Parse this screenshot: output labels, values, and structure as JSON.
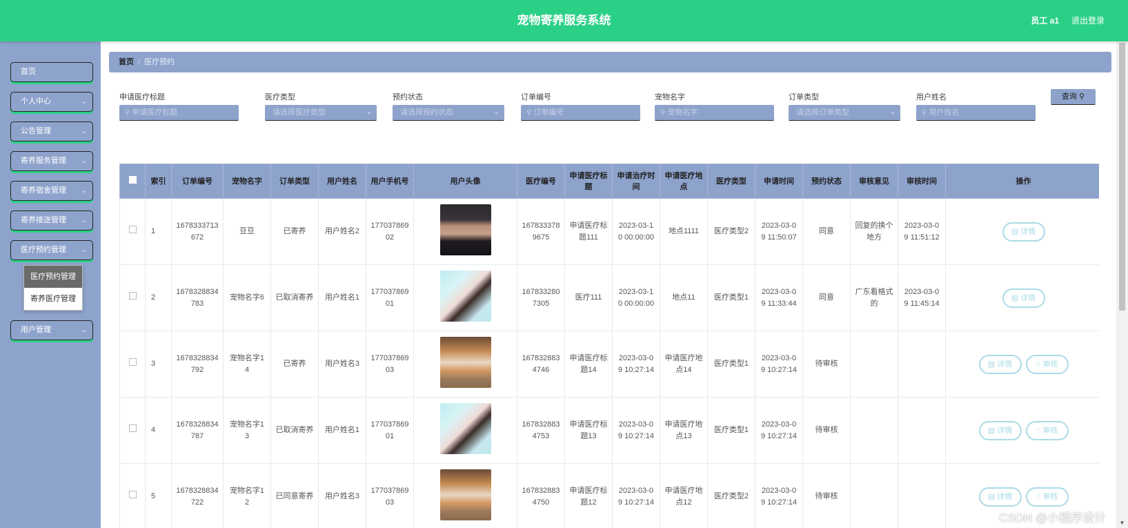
{
  "header": {
    "title": "宠物寄养服务系统",
    "user": "员工 a1",
    "logout": "退出登录"
  },
  "sidebar": {
    "items": [
      {
        "label": "首页",
        "chevron": ""
      },
      {
        "label": "个人中心",
        "chevron": "⌄"
      },
      {
        "label": "公告管理",
        "chevron": "⌄"
      },
      {
        "label": "寄养服务管理",
        "chevron": "⌄"
      },
      {
        "label": "寄养宿舍管理",
        "chevron": "⌄"
      },
      {
        "label": "寄养接送管理",
        "chevron": "⌄"
      },
      {
        "label": "医疗预约管理",
        "chevron": "⌄"
      },
      {
        "label": "用户管理",
        "chevron": "⌄"
      }
    ],
    "submenu": [
      {
        "label": "医疗预约管理",
        "active": true
      },
      {
        "label": "寄养医疗管理",
        "active": false
      }
    ]
  },
  "breadcrumb": {
    "home": "首页",
    "separator": "/",
    "current": "医疗预约"
  },
  "filters": [
    {
      "label": "申请医疗标题",
      "placeholder": "申请医疗标题",
      "type": "input"
    },
    {
      "label": "医疗类型",
      "placeholder": "请选择医疗类型",
      "type": "select"
    },
    {
      "label": "预约状态",
      "placeholder": "请选择预约状态",
      "type": "select"
    },
    {
      "label": "订单编号",
      "placeholder": "订单编号",
      "type": "input"
    },
    {
      "label": "宠物名字",
      "placeholder": "宠物名字",
      "type": "input"
    },
    {
      "label": "订单类型",
      "placeholder": "请选择订单类型",
      "type": "select"
    },
    {
      "label": "用户姓名",
      "placeholder": "用户姓名",
      "type": "input"
    }
  ],
  "query_button": "查询",
  "icons": {
    "search": "search-icon",
    "dropdown": "chevron-down-icon",
    "detail": "document-icon",
    "review": "thumb-up-icon"
  },
  "colors": {
    "header": "#2bd087",
    "accent": "#8ea3cc",
    "button_outline": "#a9dbe6"
  },
  "table": {
    "columns": [
      "",
      "索引",
      "订单编号",
      "宠物名字",
      "订单类型",
      "用户姓名",
      "用户手机号",
      "用户头像",
      "医疗编号",
      "申请医疗标题",
      "申请治疗时间",
      "申请医疗地点",
      "医疗类型",
      "申请时间",
      "预约状态",
      "审核意见",
      "审核时间",
      "操作"
    ],
    "detail_label": "详情",
    "review_label": "审核",
    "rows": [
      {
        "index": "1",
        "order_no": "1678333713672",
        "pet": "豆豆",
        "order_type": "已寄养",
        "user": "用户姓名2",
        "phone": "17703786902",
        "avatar": "man",
        "medical_no": "1678333789675",
        "title": "申请医疗标题111",
        "treat_time": "2023-03-10 00:00:00",
        "place": "地点1111",
        "med_type": "医疗类型2",
        "apply_time": "2023-03-09 11:50:07",
        "status": "同意",
        "opinion": "回复的换个地方",
        "review_time": "2023-03-09 11:51:12",
        "can_review": false
      },
      {
        "index": "2",
        "order_no": "1678328834783",
        "pet": "宠物名字6",
        "order_type": "已取消寄养",
        "user": "用户姓名1",
        "phone": "17703786901",
        "avatar": "girl",
        "medical_no": "1678332807305",
        "title": "医疗111",
        "treat_time": "2023-03-10 00:00:00",
        "place": "地点11",
        "med_type": "医疗类型1",
        "apply_time": "2023-03-09 11:33:44",
        "status": "同意",
        "opinion": "广东看格式的",
        "review_time": "2023-03-09 11:45:14",
        "can_review": false
      },
      {
        "index": "3",
        "order_no": "1678328834792",
        "pet": "宠物名字14",
        "order_type": "已寄养",
        "user": "用户姓名3",
        "phone": "17703786903",
        "avatar": "dog",
        "medical_no": "1678328834746",
        "title": "申请医疗标题14",
        "treat_time": "2023-03-09 10:27:14",
        "place": "申请医疗地点14",
        "med_type": "医疗类型1",
        "apply_time": "2023-03-09 10:27:14",
        "status": "待审核",
        "opinion": "",
        "review_time": "",
        "can_review": true
      },
      {
        "index": "4",
        "order_no": "1678328834787",
        "pet": "宠物名字13",
        "order_type": "已取消寄养",
        "user": "用户姓名1",
        "phone": "17703786901",
        "avatar": "girl",
        "medical_no": "1678328834753",
        "title": "申请医疗标题13",
        "treat_time": "2023-03-09 10:27:14",
        "place": "申请医疗地点13",
        "med_type": "医疗类型1",
        "apply_time": "2023-03-09 10:27:14",
        "status": "待审核",
        "opinion": "",
        "review_time": "",
        "can_review": true
      },
      {
        "index": "5",
        "order_no": "1678328834722",
        "pet": "宠物名字12",
        "order_type": "已同意寄养",
        "user": "用户姓名3",
        "phone": "17703786903",
        "avatar": "dog",
        "medical_no": "1678328834750",
        "title": "申请医疗标题12",
        "treat_time": "2023-03-09 10:27:14",
        "place": "申请医疗地点12",
        "med_type": "医疗类型2",
        "apply_time": "2023-03-09 10:27:14",
        "status": "待审核",
        "opinion": "",
        "review_time": "",
        "can_review": true
      }
    ]
  },
  "watermark": "CSDN @小程序设计"
}
